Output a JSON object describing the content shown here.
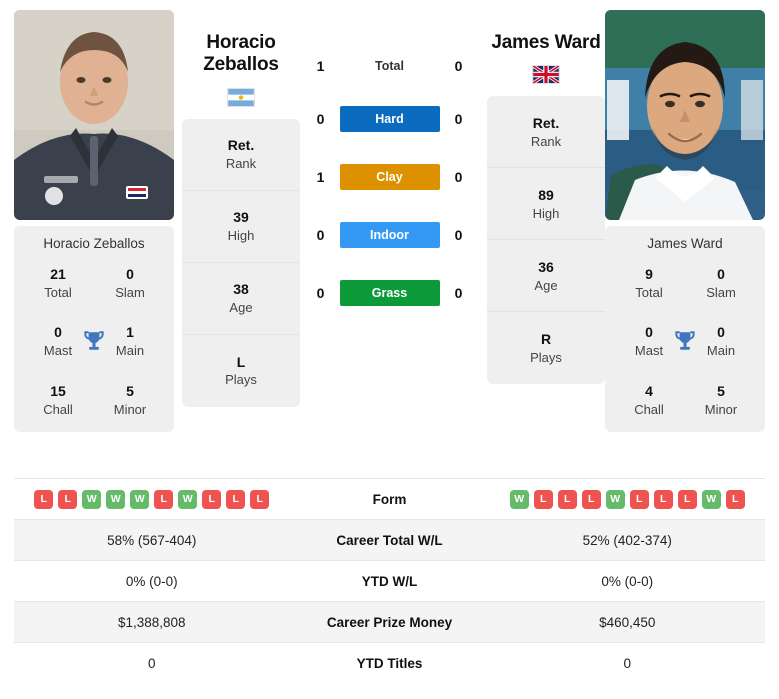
{
  "players": {
    "left": {
      "name_line1": "Horacio",
      "name_line2": "Zeballos",
      "full_name": "Horacio Zeballos",
      "flag_icon": "flag-argentina-icon",
      "flag_alt": "Argentina",
      "info": [
        {
          "value": "Ret.",
          "label": "Rank"
        },
        {
          "value": "39",
          "label": "High"
        },
        {
          "value": "38",
          "label": "Age"
        },
        {
          "value": "L",
          "label": "Plays"
        }
      ],
      "titles": [
        {
          "value": "21",
          "label": "Total"
        },
        {
          "value": "0",
          "label": "Slam"
        },
        {
          "value": "0",
          "label": "Mast"
        },
        {
          "value": "1",
          "label": "Main"
        },
        {
          "value": "15",
          "label": "Chall"
        },
        {
          "value": "5",
          "label": "Minor"
        }
      ],
      "form": [
        "L",
        "L",
        "W",
        "W",
        "W",
        "L",
        "W",
        "L",
        "L",
        "L"
      ],
      "career_total_wl": "58% (567-404)",
      "ytd_wl": "0% (0-0)",
      "career_prize_money": "$1,388,808",
      "ytd_titles": "0"
    },
    "right": {
      "name_line1": "James Ward",
      "name_line2": "",
      "full_name": "James Ward",
      "flag_icon": "flag-great-britain-icon",
      "flag_alt": "Great Britain",
      "info": [
        {
          "value": "Ret.",
          "label": "Rank"
        },
        {
          "value": "89",
          "label": "High"
        },
        {
          "value": "36",
          "label": "Age"
        },
        {
          "value": "R",
          "label": "Plays"
        }
      ],
      "titles": [
        {
          "value": "9",
          "label": "Total"
        },
        {
          "value": "0",
          "label": "Slam"
        },
        {
          "value": "0",
          "label": "Mast"
        },
        {
          "value": "0",
          "label": "Main"
        },
        {
          "value": "4",
          "label": "Chall"
        },
        {
          "value": "5",
          "label": "Minor"
        }
      ],
      "form": [
        "W",
        "L",
        "L",
        "L",
        "W",
        "L",
        "L",
        "L",
        "W",
        "L"
      ],
      "career_total_wl": "52% (402-374)",
      "ytd_wl": "0% (0-0)",
      "career_prize_money": "$460,450",
      "ytd_titles": "0"
    }
  },
  "head_to_head": [
    {
      "label": "Total",
      "left": "1",
      "right": "0",
      "badge": false,
      "color": ""
    },
    {
      "label": "Hard",
      "left": "0",
      "right": "0",
      "badge": true,
      "color": "#0b6cbf"
    },
    {
      "label": "Clay",
      "left": "1",
      "right": "0",
      "badge": true,
      "color": "#dd9000"
    },
    {
      "label": "Indoor",
      "left": "0",
      "right": "0",
      "badge": true,
      "color": "#3399f5"
    },
    {
      "label": "Grass",
      "left": "0",
      "right": "0",
      "badge": true,
      "color": "#0d9b3a"
    }
  ],
  "table_rows": [
    {
      "label": "Form",
      "type": "form"
    },
    {
      "label": "Career Total W/L",
      "type": "text",
      "left": "58% (567-404)",
      "right": "52% (402-374)"
    },
    {
      "label": "YTD W/L",
      "type": "text",
      "left": "0% (0-0)",
      "right": "0% (0-0)"
    },
    {
      "label": "Career Prize Money",
      "type": "text",
      "left": "$1,388,808",
      "right": "$460,450"
    },
    {
      "label": "YTD Titles",
      "type": "text",
      "left": "0",
      "right": "0"
    }
  ],
  "colors": {
    "panel_bg": "#efefef",
    "row_alt_bg": "#f4f4f4",
    "win_chip": "#66bb6a",
    "loss_chip": "#ef5350",
    "trophy": "#3f76bd"
  }
}
